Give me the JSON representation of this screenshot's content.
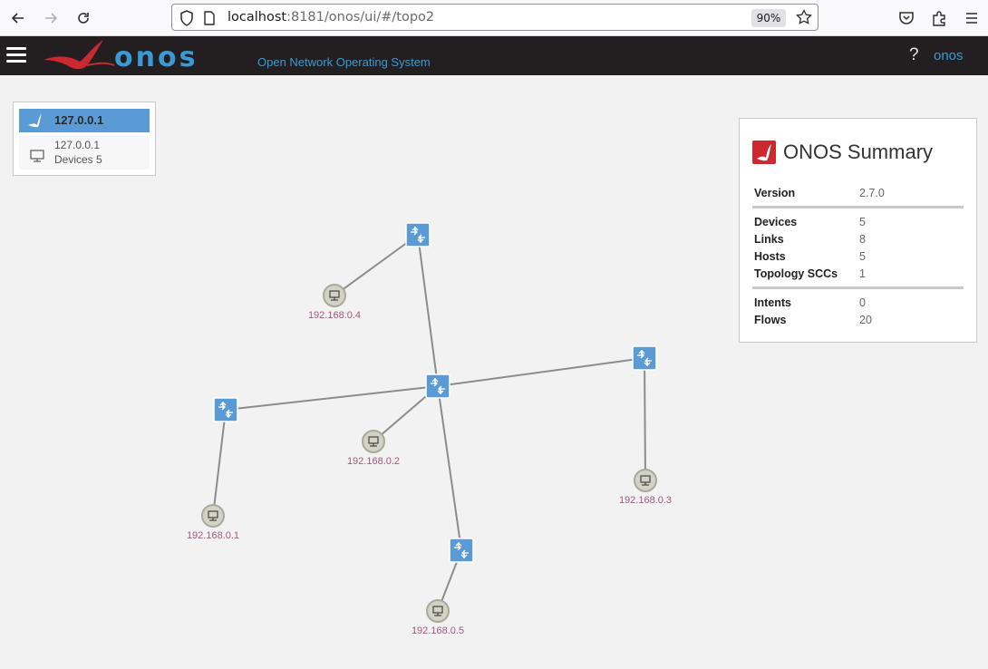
{
  "browser": {
    "url_host": "localhost",
    "url_rest": ":8181/onos/ui/#/topo2",
    "zoom": "90%"
  },
  "header": {
    "logo_text": "onos",
    "tagline": "Open Network Operating System",
    "help_label": "?",
    "user_label": "onos"
  },
  "cluster": {
    "title": "127.0.0.1",
    "node_ip": "127.0.0.1",
    "devices_text": "Devices 5"
  },
  "summary": {
    "title": "ONOS Summary",
    "version_key": "Version",
    "version_val": "2.7.0",
    "devices_key": "Devices",
    "devices_val": "5",
    "links_key": "Links",
    "links_val": "8",
    "hosts_key": "Hosts",
    "hosts_val": "5",
    "sccs_key": "Topology SCCs",
    "sccs_val": "1",
    "intents_key": "Intents",
    "intents_val": "0",
    "flows_key": "Flows",
    "flows_val": "20"
  },
  "topology": {
    "hosts": [
      "192.168.0.4",
      "192.168.0.2",
      "192.168.0.1",
      "192.168.0.3",
      "192.168.0.5"
    ]
  },
  "colors": {
    "accent": "#5b9bd5",
    "header_bg": "#231f20",
    "link": "#8c8c8c",
    "host_label": "#a05a7c",
    "onos_red": "#c9292f"
  }
}
